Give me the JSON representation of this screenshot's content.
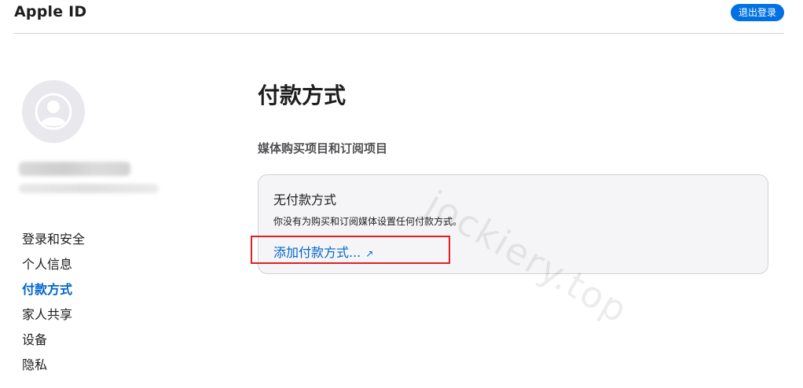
{
  "header": {
    "title": "Apple ID",
    "signout_label": "退出登录"
  },
  "sidebar": {
    "items": [
      {
        "label": "登录和安全",
        "active": false
      },
      {
        "label": "个人信息",
        "active": false
      },
      {
        "label": "付款方式",
        "active": true
      },
      {
        "label": "家人共享",
        "active": false
      },
      {
        "label": "设备",
        "active": false
      },
      {
        "label": "隐私",
        "active": false
      }
    ]
  },
  "main": {
    "title": "付款方式",
    "section_title": "媒体购买项目和订阅项目",
    "card": {
      "title": "无付款方式",
      "description": "你没有为购买和订阅媒体设置任何付款方式。",
      "add_link": "添加付款方式...",
      "add_link_icon": "external-arrow-icon"
    }
  },
  "watermark": "jockiery.top",
  "colors": {
    "accent": "#0071e3",
    "link": "#0066cc",
    "highlight": "#e02020",
    "card_bg": "#f5f5f7"
  }
}
